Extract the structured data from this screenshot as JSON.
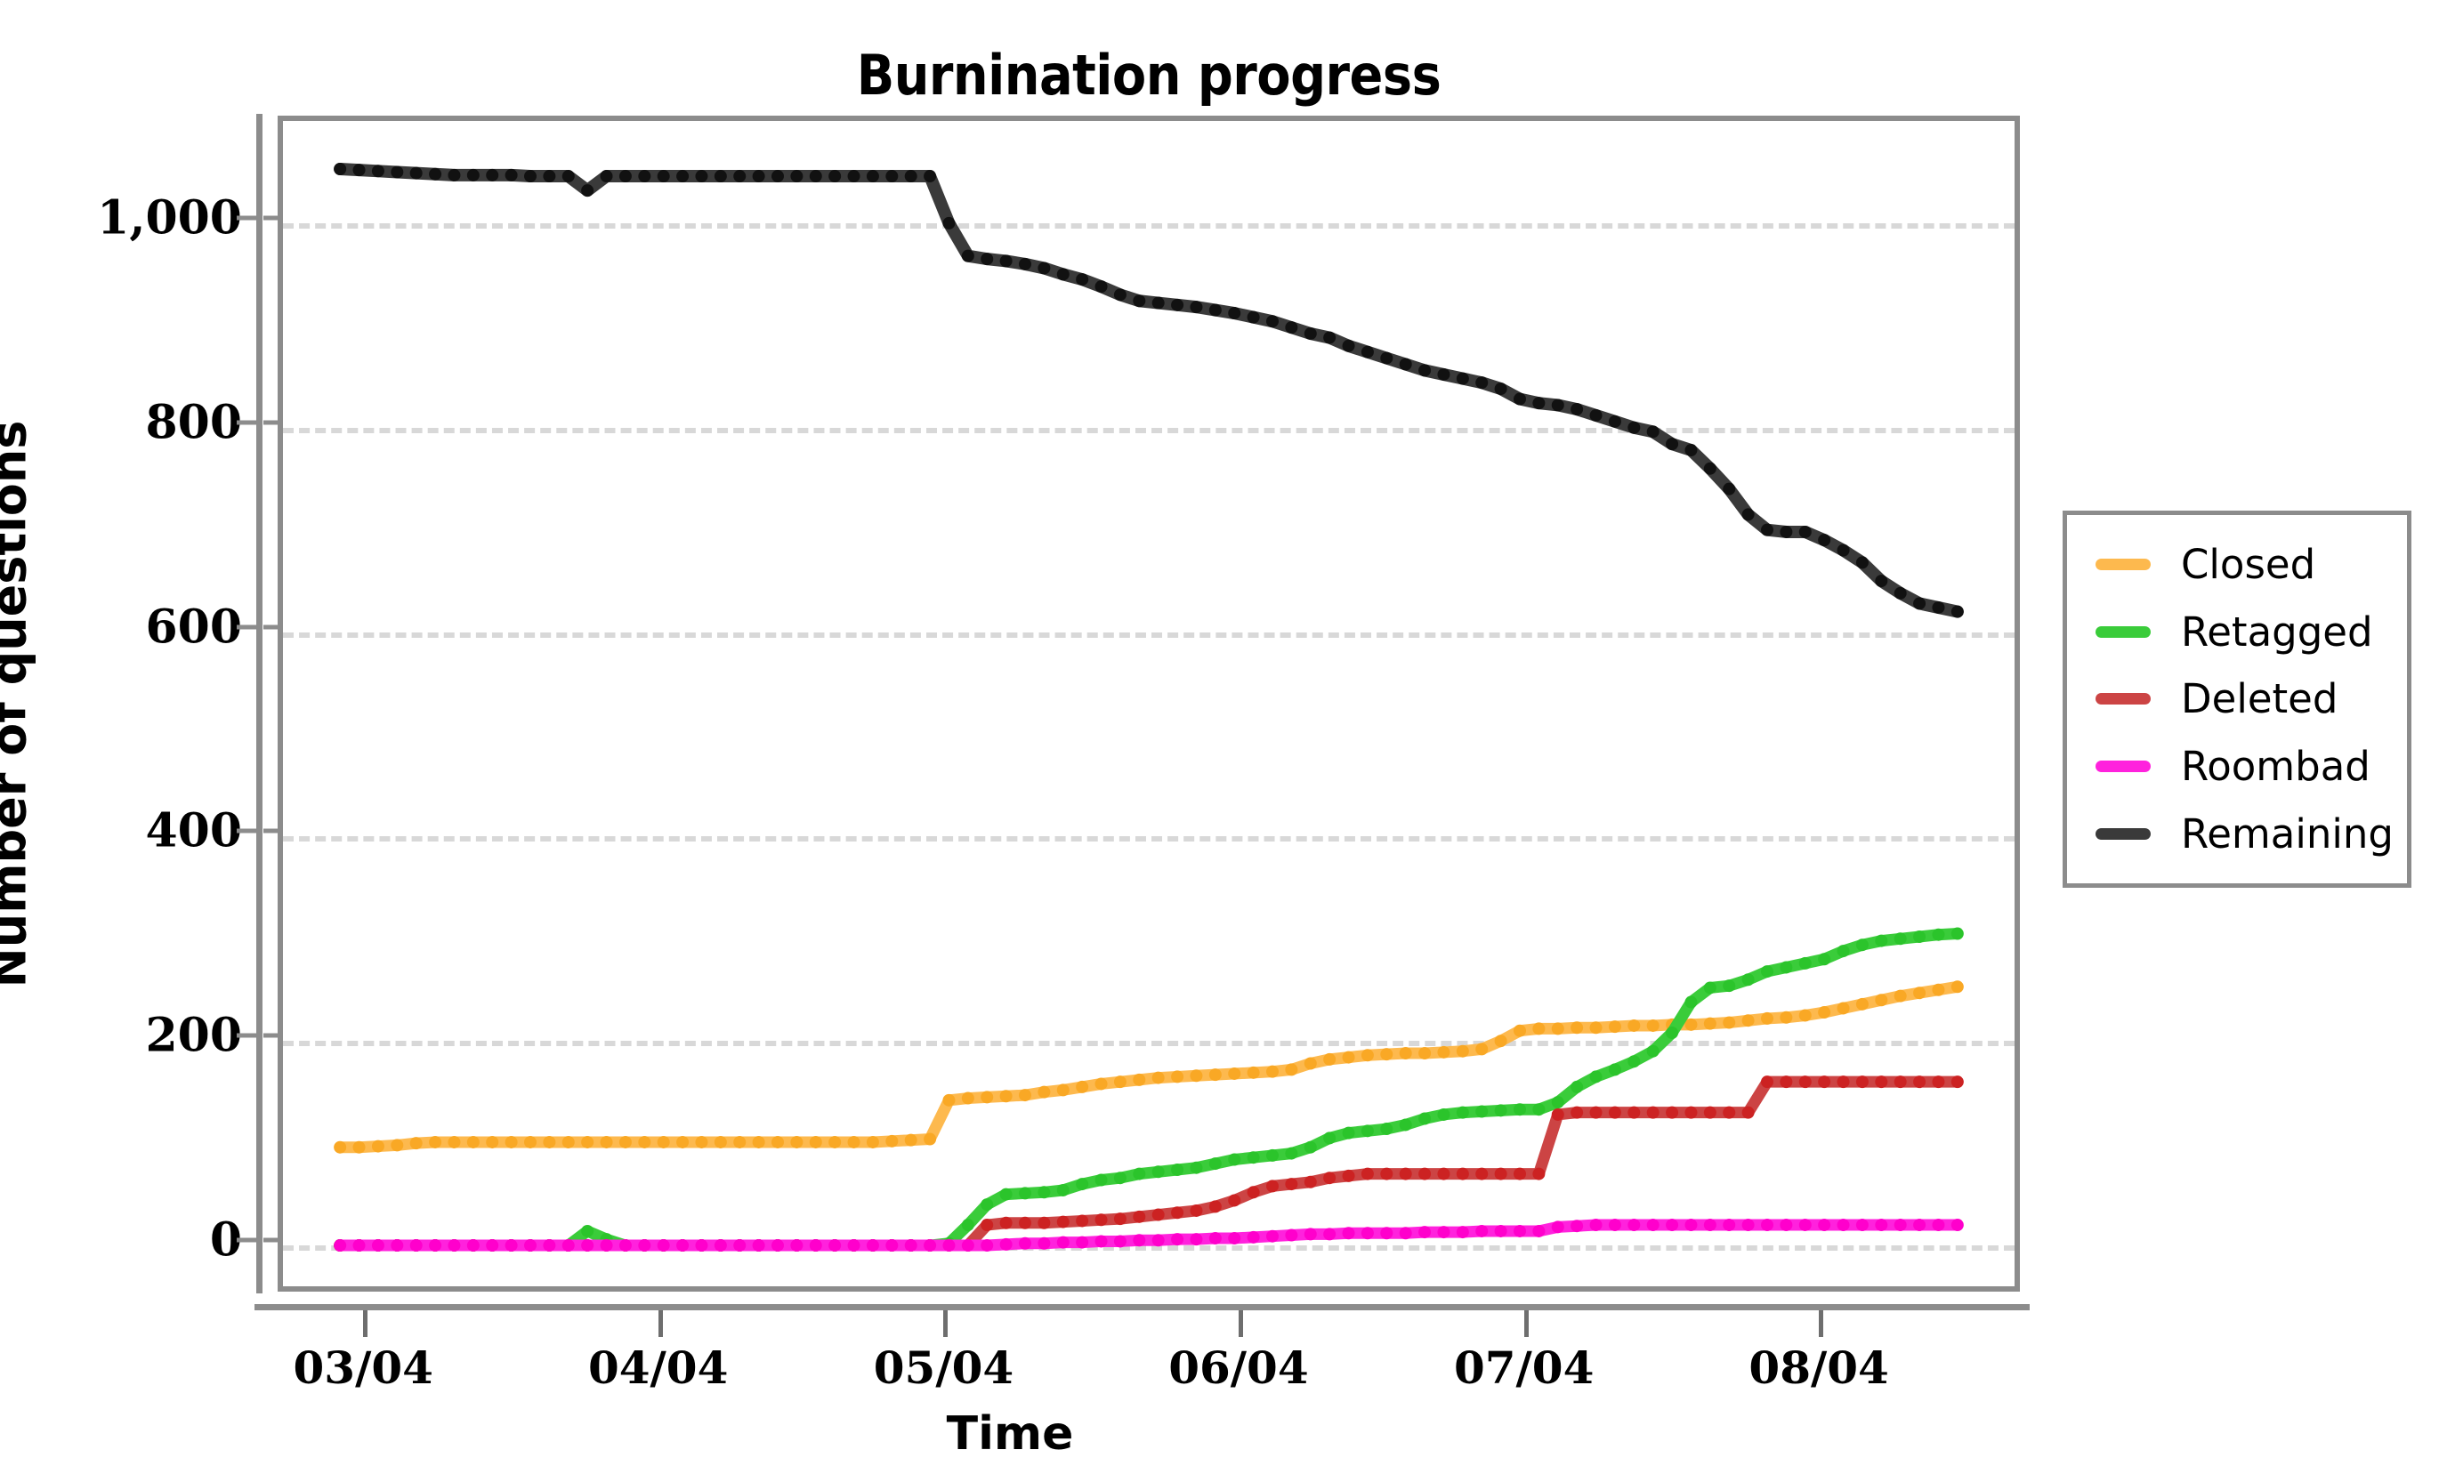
{
  "chart": {
    "title": "Burnination progress",
    "xlabel": "Time",
    "ylabel": "Number of questions"
  },
  "legend": {
    "items": [
      {
        "label": "Closed",
        "color": "#FDB94E"
      },
      {
        "label": "Retagged",
        "color": "#3ACC3A"
      },
      {
        "label": "Deleted",
        "color": "#CC4444"
      },
      {
        "label": "Roombad",
        "color": "#FF22DD"
      },
      {
        "label": "Remaining",
        "color": "#3A3A3A"
      }
    ]
  },
  "chart_data": {
    "type": "line",
    "title": "Burnination progress",
    "xlabel": "Time",
    "ylabel": "Number of questions",
    "xtick_labels": [
      "03/04",
      "04/04",
      "05/04",
      "06/04",
      "07/04",
      "08/04"
    ],
    "xtick_values": [
      3,
      34,
      64,
      95,
      125,
      156
    ],
    "ytick_labels": [
      "0",
      "200",
      "400",
      "600",
      "800",
      "1,000"
    ],
    "ytick_values": [
      0,
      200,
      400,
      600,
      800,
      1000
    ],
    "ylim": [
      -40,
      1100
    ],
    "xlim": [
      -6,
      176
    ],
    "grid": "horizontal-dashed",
    "legend_position": "right",
    "x": [
      0,
      2,
      4,
      6,
      8,
      10,
      12,
      14,
      16,
      18,
      20,
      22,
      24,
      26,
      28,
      30,
      32,
      34,
      36,
      38,
      40,
      42,
      44,
      46,
      48,
      50,
      52,
      54,
      56,
      58,
      60,
      62,
      64,
      66,
      68,
      70,
      72,
      74,
      76,
      78,
      80,
      82,
      84,
      86,
      88,
      90,
      92,
      94,
      96,
      98,
      100,
      102,
      104,
      106,
      108,
      110,
      112,
      114,
      116,
      118,
      120,
      122,
      124,
      126,
      128,
      130,
      132,
      134,
      136,
      138,
      140,
      142,
      144,
      146,
      148,
      150,
      152,
      154,
      156,
      158,
      160,
      162,
      164,
      166,
      168,
      170
    ],
    "series": [
      {
        "name": "Closed",
        "color": "#FDB94E",
        "values": [
          96,
          96,
          97,
          98,
          100,
          101,
          101,
          101,
          101,
          101,
          101,
          101,
          101,
          101,
          101,
          101,
          101,
          101,
          101,
          101,
          101,
          101,
          101,
          101,
          101,
          101,
          101,
          101,
          101,
          102,
          103,
          104,
          142,
          144,
          145,
          146,
          147,
          150,
          152,
          155,
          158,
          160,
          162,
          164,
          165,
          166,
          167,
          168,
          169,
          170,
          172,
          178,
          182,
          184,
          186,
          187,
          188,
          188,
          189,
          190,
          192,
          200,
          210,
          212,
          212,
          213,
          213,
          214,
          215,
          215,
          216,
          216,
          217,
          218,
          220,
          222,
          223,
          225,
          228,
          232,
          236,
          240,
          244,
          247,
          250,
          253
        ]
      },
      {
        "name": "Retagged",
        "color": "#3ACC3A",
        "values": [
          0,
          0,
          0,
          0,
          0,
          0,
          0,
          0,
          0,
          0,
          0,
          0,
          0,
          14,
          6,
          0,
          0,
          0,
          0,
          0,
          0,
          0,
          0,
          0,
          0,
          0,
          0,
          0,
          0,
          0,
          0,
          0,
          2,
          20,
          40,
          50,
          51,
          52,
          54,
          60,
          64,
          66,
          70,
          72,
          74,
          76,
          80,
          84,
          86,
          88,
          90,
          96,
          105,
          110,
          112,
          114,
          118,
          124,
          128,
          130,
          131,
          132,
          133,
          133,
          140,
          155,
          165,
          172,
          180,
          190,
          208,
          238,
          252,
          254,
          260,
          268,
          272,
          276,
          280,
          288,
          294,
          298,
          300,
          302,
          304,
          305
        ]
      },
      {
        "name": "Deleted",
        "color": "#CC4444",
        "values": [
          0,
          0,
          0,
          0,
          0,
          0,
          0,
          0,
          0,
          0,
          0,
          0,
          0,
          0,
          0,
          0,
          0,
          0,
          0,
          0,
          0,
          0,
          0,
          0,
          0,
          0,
          0,
          0,
          0,
          0,
          0,
          0,
          0,
          0,
          20,
          22,
          22,
          22,
          23,
          24,
          25,
          26,
          28,
          30,
          32,
          34,
          38,
          44,
          52,
          58,
          60,
          62,
          66,
          68,
          70,
          70,
          70,
          70,
          70,
          70,
          70,
          70,
          70,
          70,
          128,
          130,
          130,
          130,
          130,
          130,
          130,
          130,
          130,
          130,
          130,
          160,
          160,
          160,
          160,
          160,
          160,
          160,
          160,
          160,
          160,
          160
        ]
      },
      {
        "name": "Roombad",
        "color": "#FF22DD",
        "values": [
          0,
          0,
          0,
          0,
          0,
          0,
          0,
          0,
          0,
          0,
          0,
          0,
          0,
          0,
          0,
          0,
          0,
          0,
          0,
          0,
          0,
          0,
          0,
          0,
          0,
          0,
          0,
          0,
          0,
          0,
          0,
          0,
          0,
          0,
          0,
          1,
          2,
          2,
          3,
          3,
          4,
          4,
          5,
          5,
          6,
          6,
          7,
          7,
          8,
          9,
          10,
          11,
          11,
          12,
          12,
          12,
          12,
          13,
          13,
          13,
          14,
          14,
          14,
          14,
          18,
          19,
          20,
          20,
          20,
          20,
          20,
          20,
          20,
          20,
          20,
          20,
          20,
          20,
          20,
          20,
          20,
          20,
          20,
          20,
          20,
          20
        ]
      },
      {
        "name": "Remaining",
        "color": "#3A3A3A",
        "values": [
          1053,
          1052,
          1051,
          1050,
          1049,
          1048,
          1047,
          1047,
          1047,
          1047,
          1046,
          1046,
          1046,
          1032,
          1046,
          1046,
          1046,
          1046,
          1046,
          1046,
          1046,
          1046,
          1046,
          1046,
          1046,
          1046,
          1046,
          1046,
          1046,
          1046,
          1046,
          1046,
          1000,
          968,
          965,
          963,
          960,
          956,
          950,
          945,
          938,
          930,
          924,
          922,
          920,
          918,
          915,
          912,
          908,
          904,
          898,
          892,
          888,
          880,
          874,
          868,
          862,
          856,
          852,
          848,
          844,
          838,
          828,
          824,
          822,
          818,
          812,
          806,
          800,
          796,
          784,
          778,
          760,
          740,
          715,
          700,
          698,
          698,
          690,
          680,
          668,
          650,
          638,
          628,
          624,
          620
        ]
      }
    ]
  }
}
